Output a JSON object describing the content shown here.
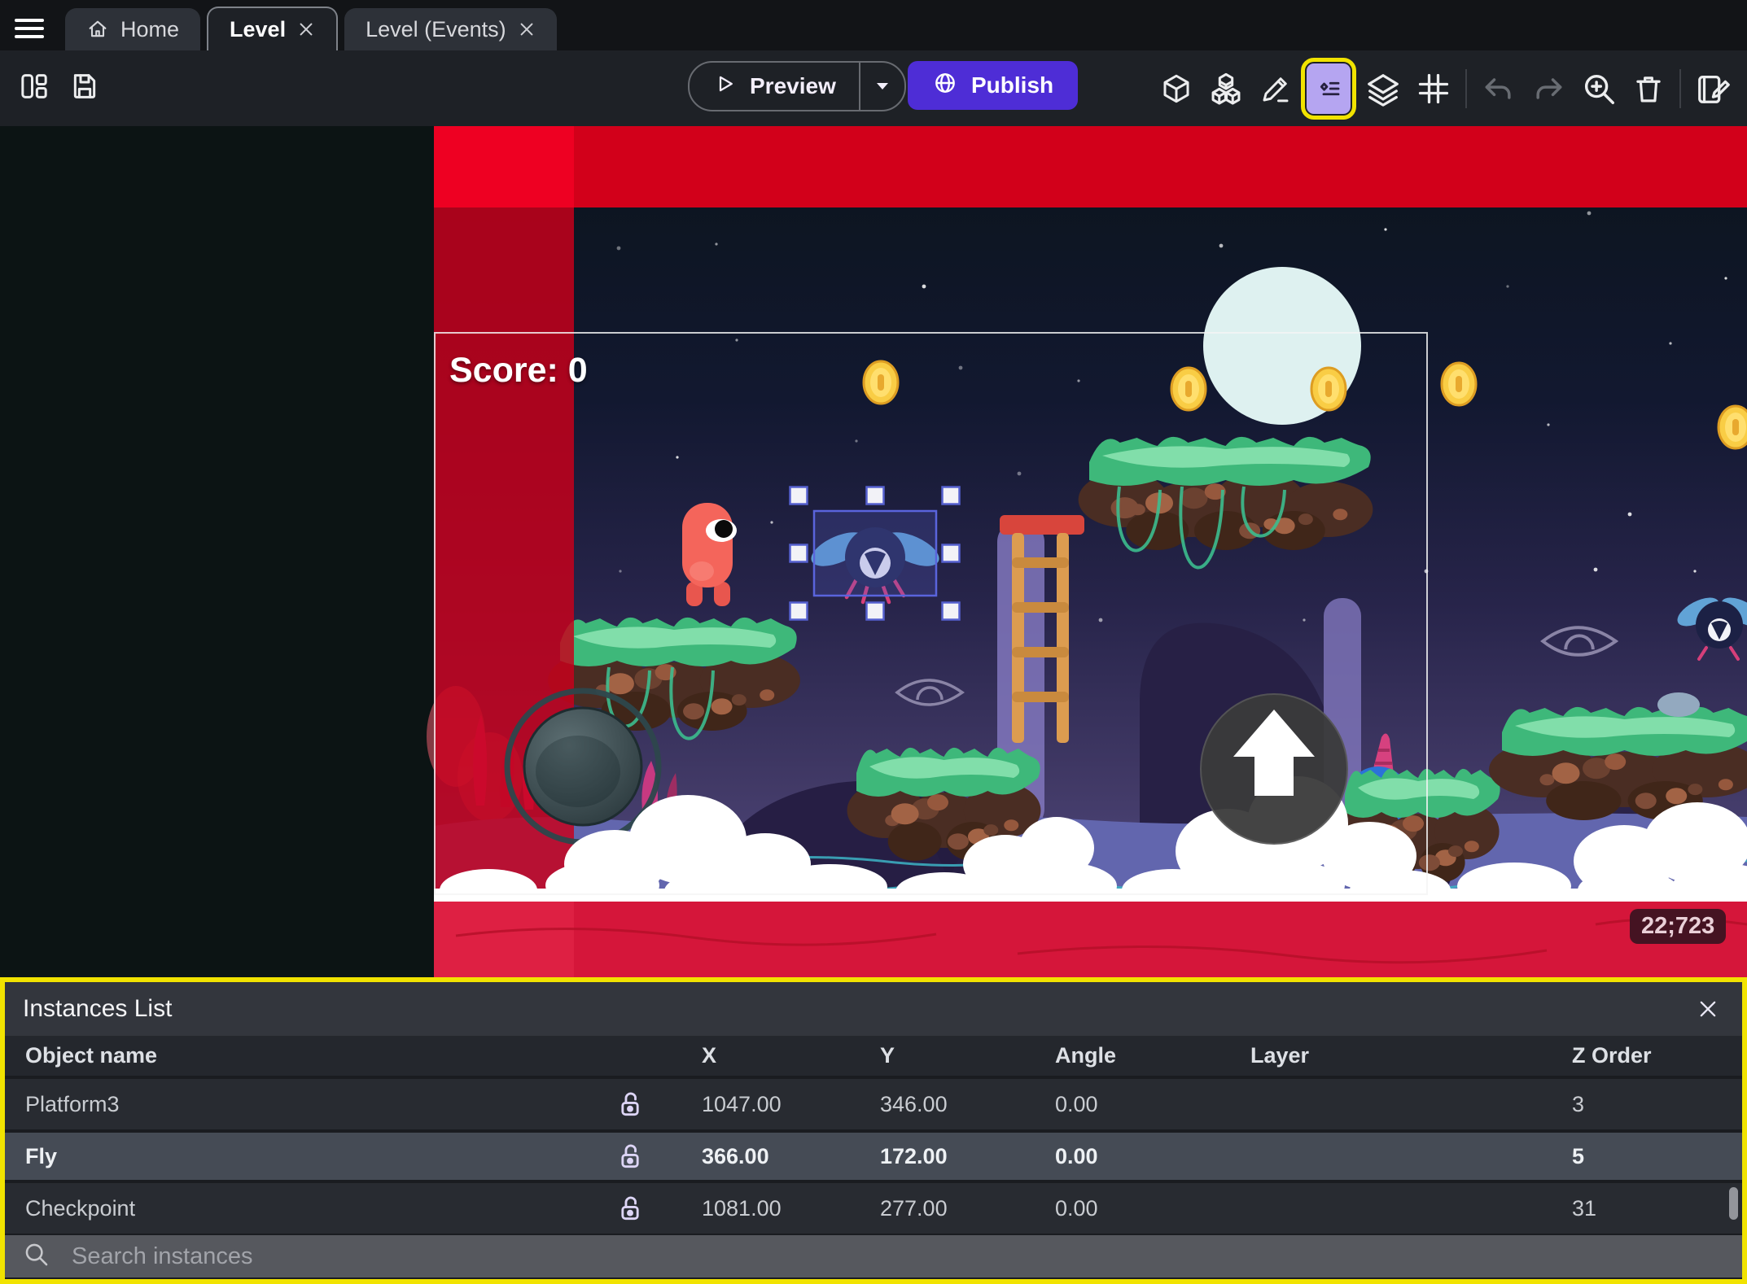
{
  "tabs": {
    "home": "Home",
    "level": "Level",
    "events": "Level (Events)"
  },
  "toolbar": {
    "preview_label": "Preview",
    "publish_label": "Publish",
    "left_icons": [
      "panel-layout",
      "save"
    ],
    "right_icons": [
      "objects-list-cube",
      "object-groups",
      "edit-scene-pencil",
      "instances-list",
      "layers",
      "grid",
      "undo",
      "redo",
      "zoom-in",
      "delete",
      "scene-properties"
    ]
  },
  "scene": {
    "score_text": "Score: 0",
    "cursor_coords": "22;723"
  },
  "instances_panel": {
    "title": "Instances List",
    "columns": {
      "name": "Object name",
      "x": "X",
      "y": "Y",
      "angle": "Angle",
      "layer": "Layer",
      "z_order": "Z Order"
    },
    "rows": [
      {
        "name": "Platform3",
        "x": "1047.00",
        "y": "346.00",
        "angle": "0.00",
        "layer": "",
        "z_order": "3",
        "locked": false,
        "selected": false
      },
      {
        "name": "Fly",
        "x": "366.00",
        "y": "172.00",
        "angle": "0.00",
        "layer": "",
        "z_order": "5",
        "locked": false,
        "selected": true
      },
      {
        "name": "Checkpoint",
        "x": "1081.00",
        "y": "277.00",
        "angle": "0.00",
        "layer": "",
        "z_order": "31",
        "locked": false,
        "selected": false
      }
    ],
    "search_placeholder": "Search instances"
  },
  "colors": {
    "accent_purple": "#4e2dd6",
    "annotation_yellow": "#f1e300",
    "selection_blue": "#5a64dc",
    "world_bound_red": "#d2001a",
    "icon_highlight_bg": "#b5a5f1"
  }
}
